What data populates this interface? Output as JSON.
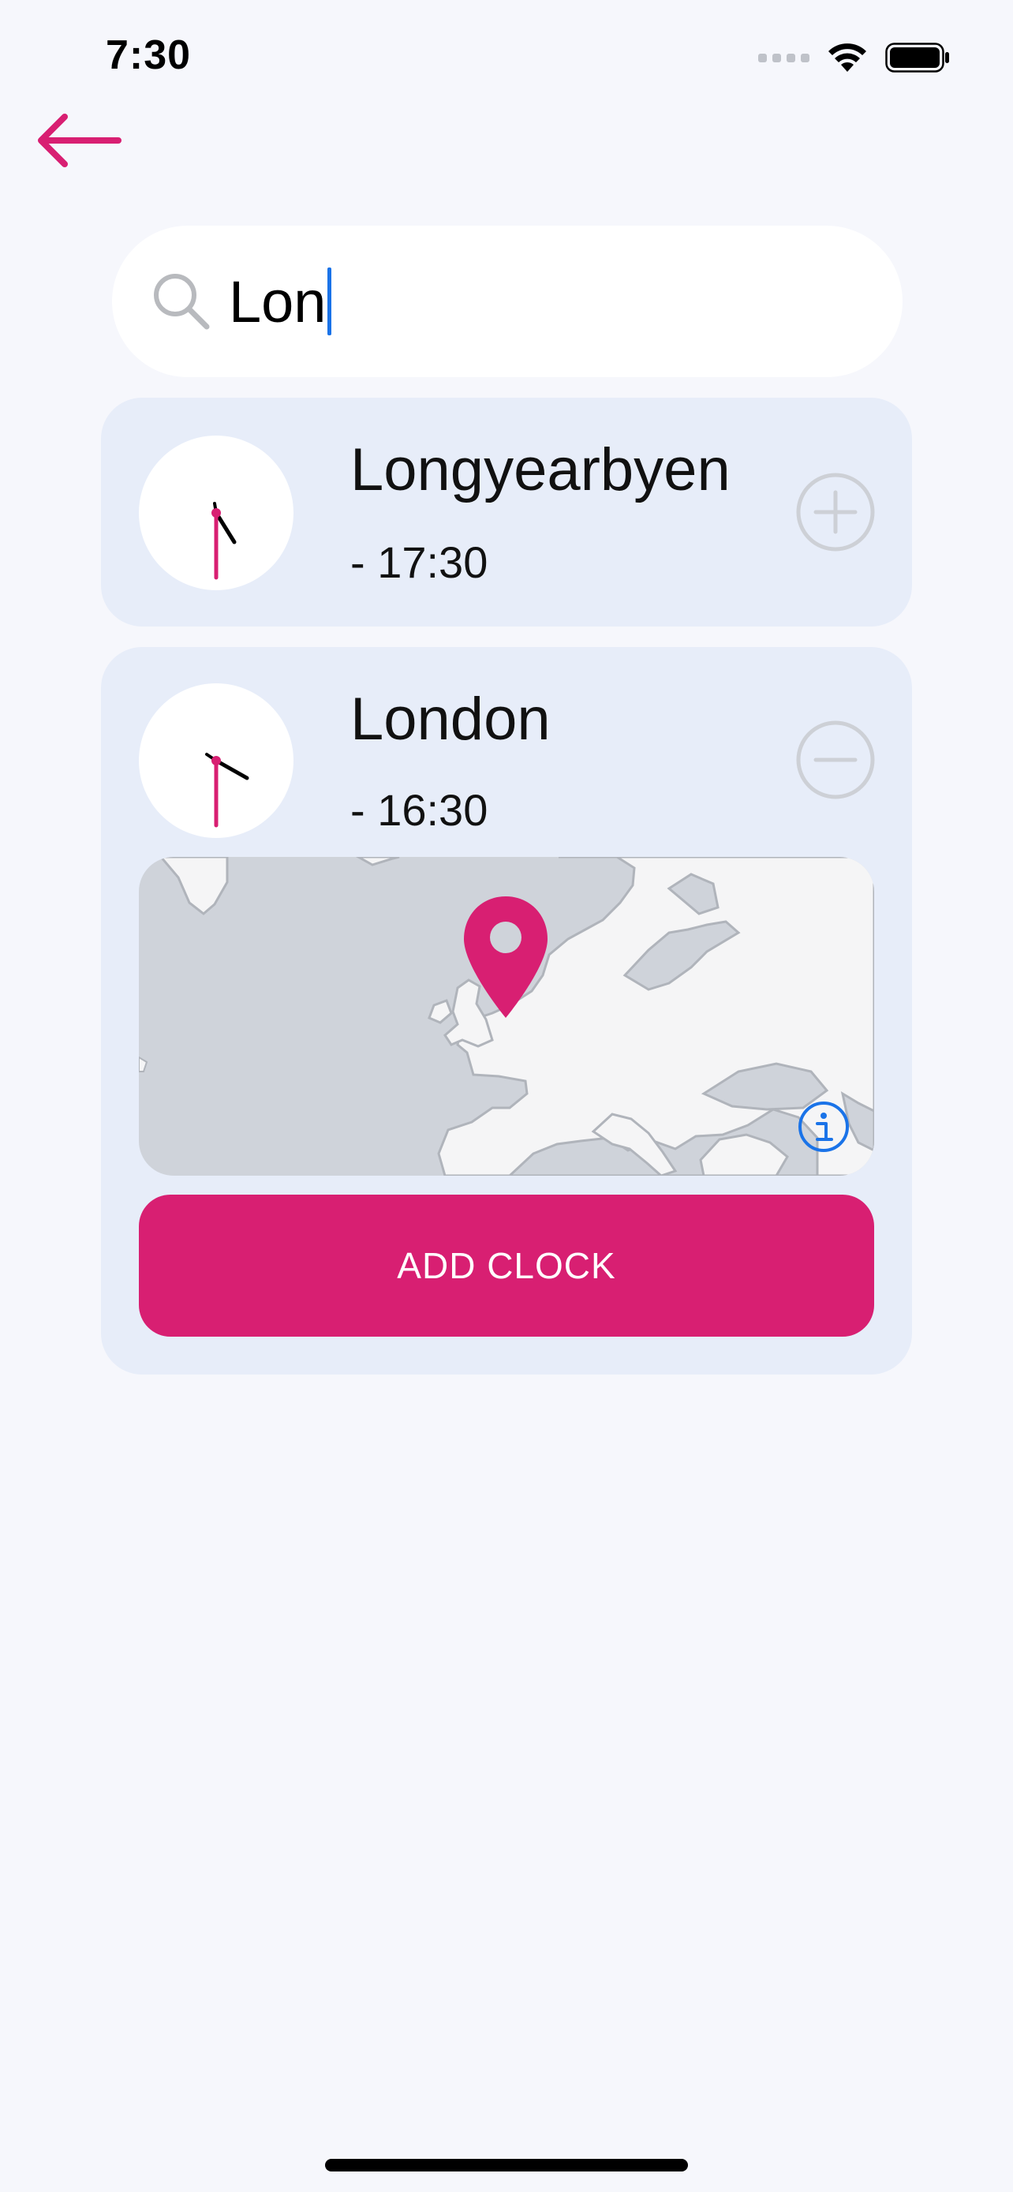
{
  "status_bar": {
    "time": "7:30"
  },
  "search": {
    "value": "Lon"
  },
  "results": [
    {
      "city": "Longyearbyen",
      "time": "- 17:30",
      "action": "add-circle"
    },
    {
      "city": "London",
      "time": "- 16:30",
      "action": "remove-circle",
      "expanded": true
    }
  ],
  "add_button_label": "ADD CLOCK",
  "colors": {
    "accent": "#d81f72",
    "background": "#f6f7fc",
    "card": "#e7edf9",
    "icon_muted": "#cdd0d6",
    "info_blue": "#1a73e8",
    "map_sea": "#cfd3da",
    "map_land": "#f5f5f6"
  },
  "icons": {
    "back": "arrow-left-icon",
    "search": "magnifier-icon",
    "info": "info-icon",
    "pin": "map-pin-icon"
  }
}
